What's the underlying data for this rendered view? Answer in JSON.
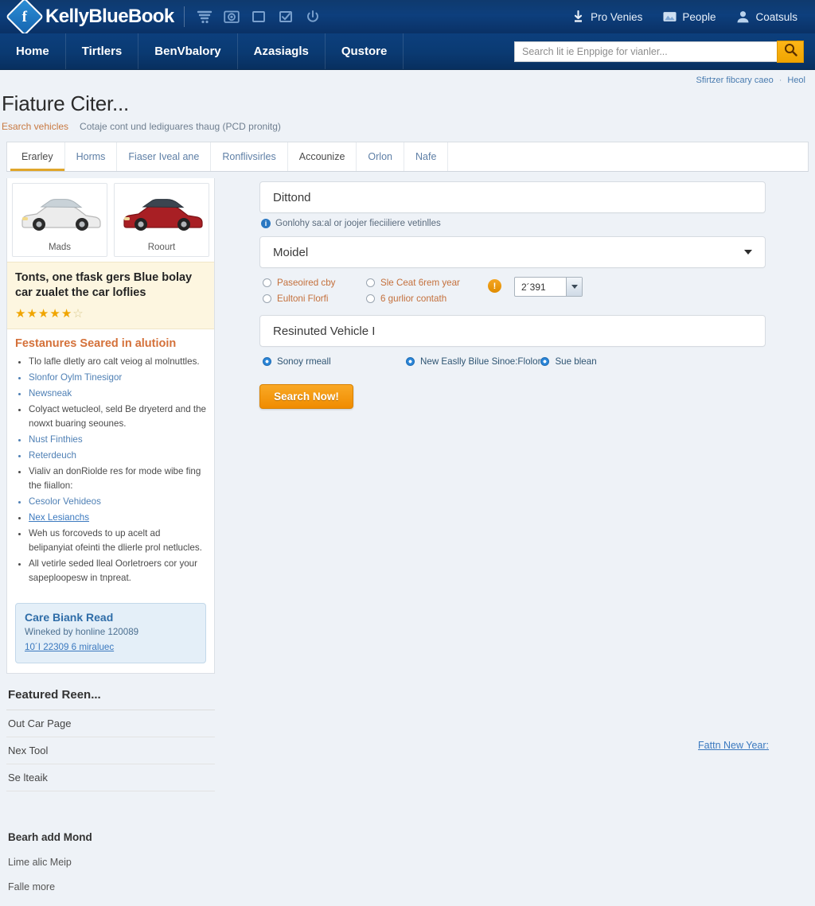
{
  "header": {
    "brand": "KellyBlueBook",
    "logo_glyph": "f",
    "icons": [
      "funnel-icon",
      "camera-icon",
      "square-icon",
      "checkbox-icon",
      "power-icon"
    ],
    "links": [
      {
        "label": "Pro Venies",
        "icon": "download-icon"
      },
      {
        "label": "People",
        "icon": "image-icon"
      },
      {
        "label": "Coatsuls",
        "icon": "user-icon"
      }
    ]
  },
  "nav": {
    "items": [
      "Home",
      "Tirtlers",
      "BenVbalory",
      "Azasiagls",
      "Qustore"
    ],
    "search": {
      "placeholder": "Search lit ie Enppige for vianler...",
      "value": "",
      "button_icon": "search-icon"
    }
  },
  "utility": {
    "link": "Sfirtzer fibcary caeo",
    "dot": "·",
    "link2": "Heol"
  },
  "page": {
    "title": "Fiature Citer...",
    "breadcrumb_1": "Esarch vehicles",
    "breadcrumb_2": "Cotaje cont und lediguares thaug (PCD pronitg)"
  },
  "tabs": [
    {
      "label": "Erarley",
      "active": true
    },
    {
      "label": "Horms",
      "active": false
    },
    {
      "label": "Fiaser Iveal ane",
      "active": false
    },
    {
      "label": "Ronflivsirles",
      "active": false
    },
    {
      "label": "Accounize",
      "active": false,
      "dark": true
    },
    {
      "label": "Orlon",
      "active": false
    },
    {
      "label": "Nafe",
      "active": false
    }
  ],
  "sidebar": {
    "cars": [
      {
        "caption": "Mads",
        "color": "#e9eaec"
      },
      {
        "caption": "Roourt",
        "color": "#a81f24"
      }
    ],
    "promo": {
      "headline": "Tonts, one tfask gers Blue bolay car zualet the car loflies",
      "stars_filled": 5,
      "stars_total": 6
    },
    "features_heading": "Festanures Seared in alutioin",
    "features": [
      {
        "text": "Tlo lafle dletly aro calt veiog al molnuttles.",
        "style": "plain"
      },
      {
        "text": "Slonfor Oylm Tinesigor",
        "style": "link"
      },
      {
        "text": "Newsneak",
        "style": "link"
      },
      {
        "text": "Colyact wetucleol, seld Be dryeterd and the nowxt buaring seounes.",
        "style": "plain"
      },
      {
        "text": "Nust Finthies",
        "style": "link"
      },
      {
        "text": "Reterdeuch",
        "style": "link"
      },
      {
        "text": "Vialiv an donRiolde res for mode wibe fing the fiiallon:",
        "style": "plain"
      },
      {
        "text": "Cesolor Vehideos",
        "style": "link"
      },
      {
        "text": "Nex Lesianchs",
        "style": "underline"
      },
      {
        "text": "Weh us forcoveds to up acelt ad belipanyiat ofeinti the dlierle prol netlucles.",
        "style": "plain"
      },
      {
        "text": "All vetirle seded lleal Oorletroers cor your sapeploopesw in tnpreat.",
        "style": "plain-embed",
        "embed": "lleal Oorletroers"
      }
    ],
    "note": {
      "title": "Care Biank Read",
      "subtitle": "Wineked by honline 120089",
      "link": "10´I 22309 6 miralueс"
    }
  },
  "featured": {
    "heading": "Featured Reen...",
    "rows": [
      "Out Car Page",
      "Nex Tool",
      "Se lteaik"
    ]
  },
  "footer": {
    "heading": "Bearh add Mond",
    "links": [
      "Lime alic Meip",
      "Falle more"
    ],
    "right_link": "Fattn New Year:"
  },
  "form": {
    "make_field": {
      "value": "Dittond",
      "name": "make"
    },
    "hint": {
      "icon": "info-icon",
      "text": "Gonlohy sa:al or joojer fieciiliere vetinlles"
    },
    "model_field": {
      "value": "Moidel",
      "name": "model"
    },
    "radios_col1": [
      {
        "label": "Paseoired cby",
        "selected": false
      },
      {
        "label": "Eultoni Florfi",
        "selected": false
      }
    ],
    "radios_col2": [
      {
        "label": "Sle Ceat 6rem year",
        "selected": false
      },
      {
        "label": "6 gurlior contath",
        "selected": false
      }
    ],
    "warn_badge": "!",
    "year_select": {
      "value": "2´391",
      "icon": "chevron-down-icon"
    },
    "vehicle_field": {
      "value": "Resinuted Vehicle I",
      "name": "vehicle"
    },
    "radios_row": [
      {
        "label": "Sonoy rmeall",
        "selected": true
      },
      {
        "label": "New Easlly Bilue Sinoe:Flolor",
        "selected": true
      },
      {
        "label": "Sue blean",
        "selected": true
      }
    ],
    "submit_label": "Search Now!"
  },
  "colors": {
    "header_blue": "#0c3f7d",
    "accent_orange": "#f0a500",
    "link_blue": "#3b79bf",
    "promo_cream": "#fdf6e0"
  }
}
